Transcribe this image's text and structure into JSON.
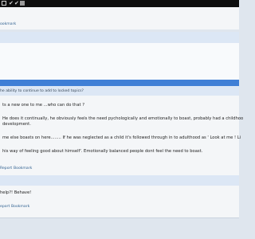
{
  "status_icons": [
    "square-icon",
    "check-icon",
    "check-icon",
    "image-icon"
  ],
  "post1": {
    "bookmark": "ookmark"
  },
  "banner_question": "he ability to continue to add to locked topics?",
  "post2": {
    "lines": [
      "ts a new one to me ...who can do that ?",
      "He does it continually, he obviously feels the need pychologically and emotionally to boast, probably had a childhoo",
      " development.",
      "me else boasts on here........ If he was neglected as a child it's followed through in to adulthood as ' Look at me ! Li",
      "his way of feeling good about himself'. Emotionally balanced people dont feel the need to boast."
    ],
    "report": "Report",
    "bookmark": "Bookmark"
  },
  "post3": {
    "text": "help?! Behave!",
    "report": "eport",
    "bookmark": "Bookmark"
  },
  "colors": {
    "page_bg": "#dfe6ee",
    "panel_bg": "#f4f6f8",
    "accent_blue": "#3f7fd6",
    "light_band": "#dce7f5",
    "link": "#2d5f8f"
  }
}
